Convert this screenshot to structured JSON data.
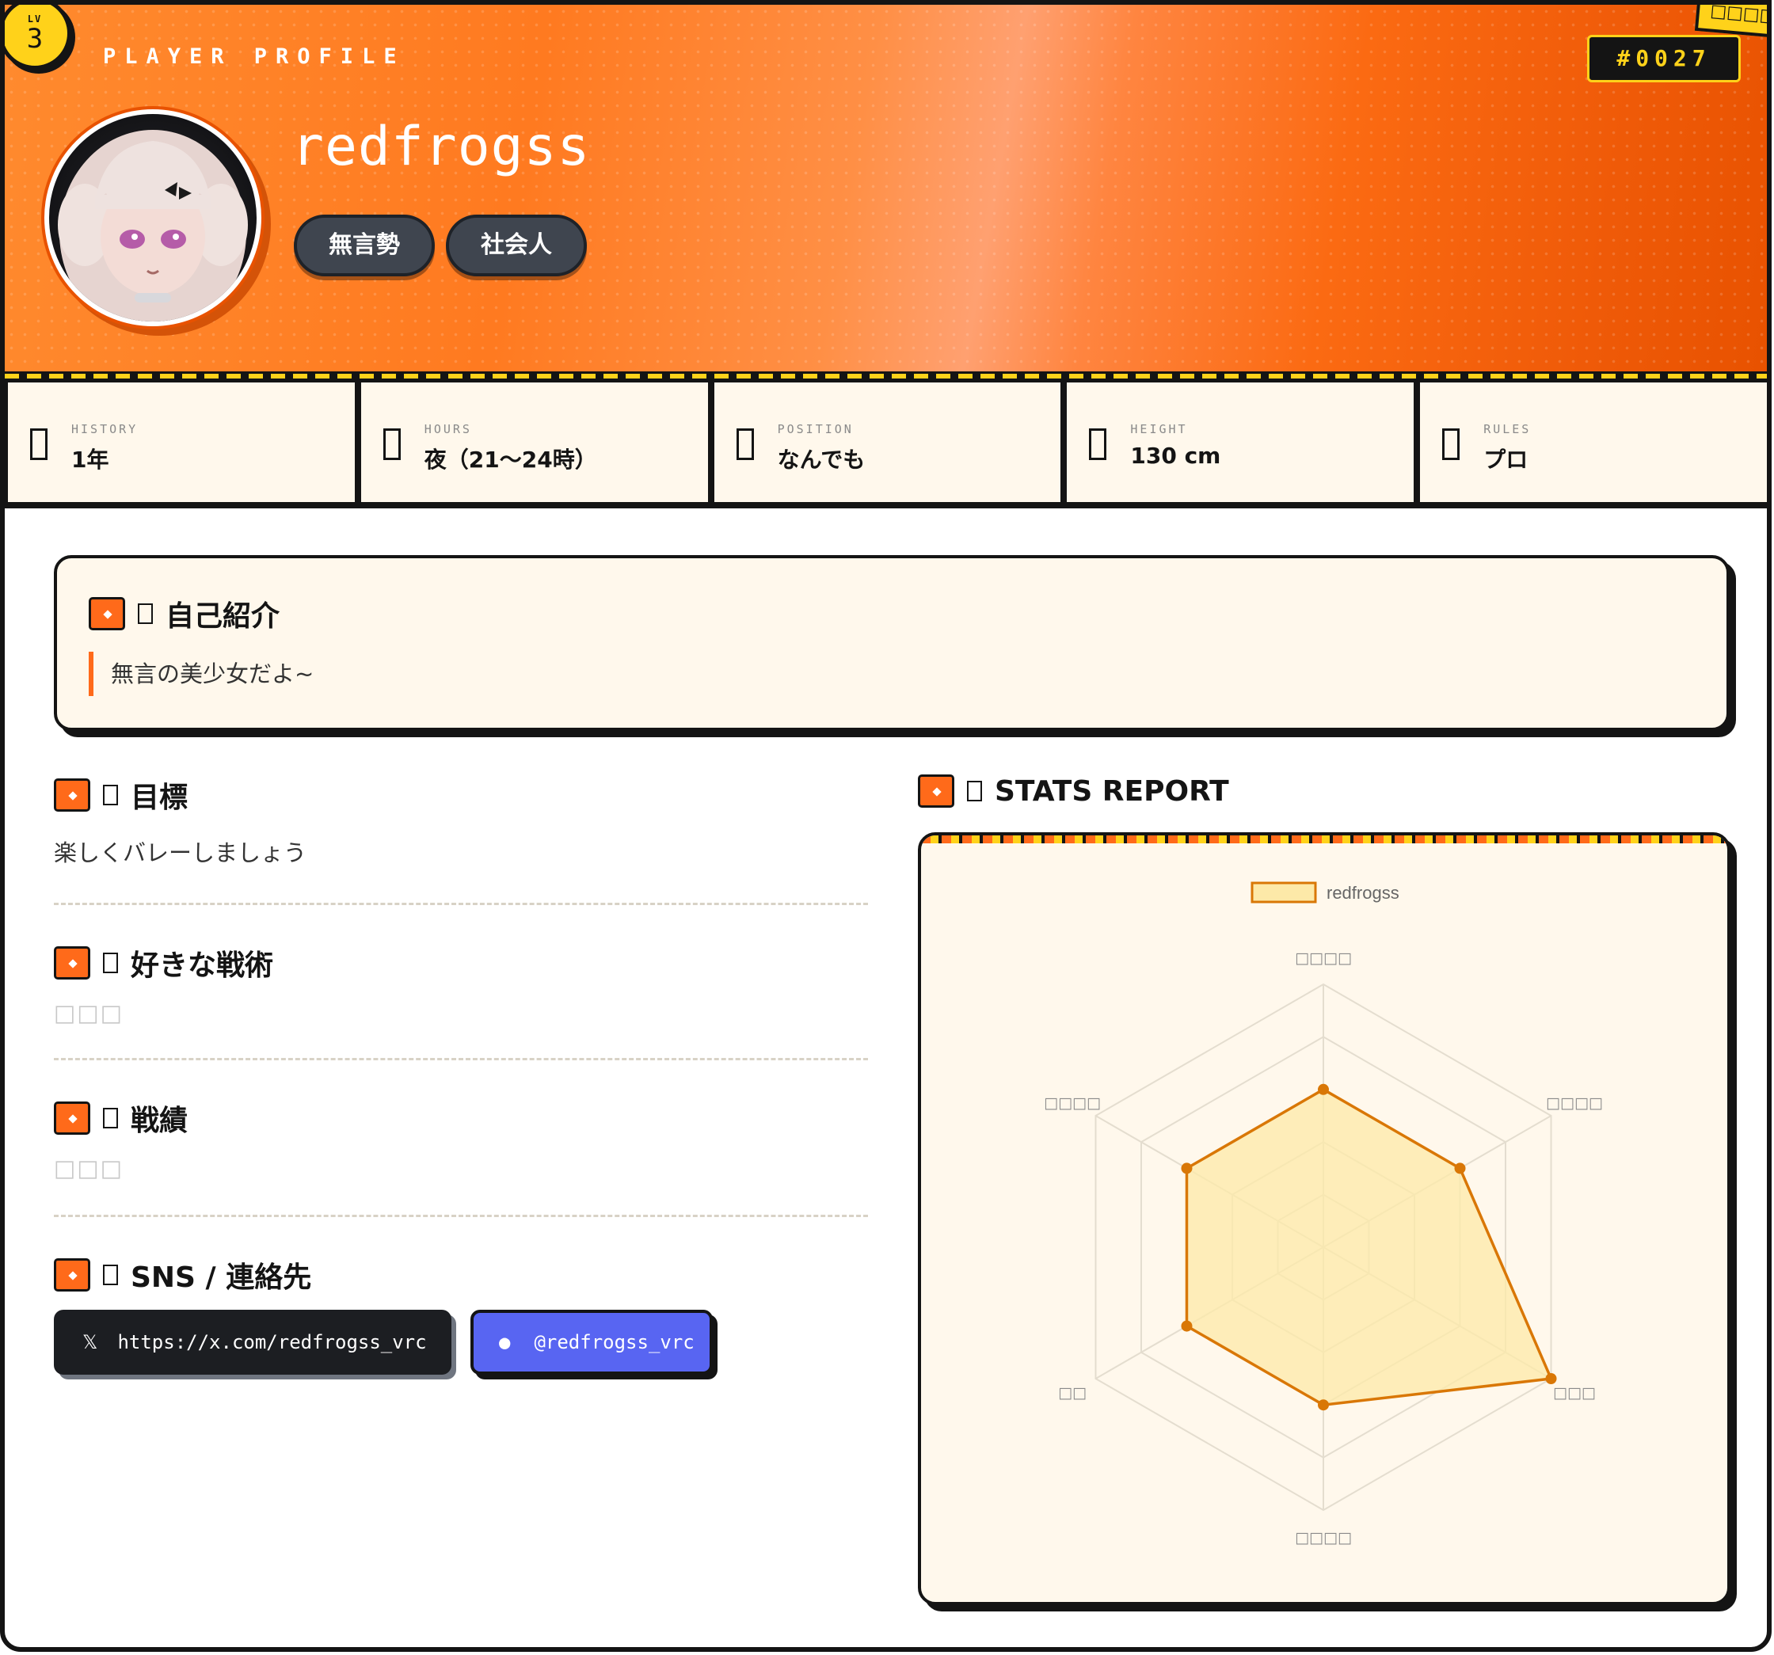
{
  "header": {
    "level_label": "LV",
    "level": "3",
    "section_label": "PLAYER PROFILE",
    "player_id": "#0027",
    "corner_tag": "□□□□",
    "username": "redfrogss",
    "tags": [
      "無言勢",
      "社会人"
    ]
  },
  "stats": [
    {
      "label": "HISTORY",
      "value": "1年",
      "icon": "history-icon"
    },
    {
      "label": "HOURS",
      "value": "夜（21〜24時）",
      "icon": "clock-icon"
    },
    {
      "label": "POSITION",
      "value": "なんでも",
      "icon": "position-icon"
    },
    {
      "label": "HEIGHT",
      "value": "130 cm",
      "icon": "ruler-icon"
    },
    {
      "label": "RULES",
      "value": "プロ",
      "icon": "rules-icon"
    }
  ],
  "intro": {
    "title": "自己紹介",
    "text": "無言の美少女だよ~"
  },
  "goal": {
    "title": "目標",
    "text": "楽しくバレーしましょう"
  },
  "tactics": {
    "title": "好きな戦術",
    "text": "□□□"
  },
  "record": {
    "title": "戦績",
    "text": "□□□"
  },
  "sns": {
    "title": "SNS / 連絡先",
    "x_glyph": "𝕏",
    "x_url": "https://x.com/redfrogss_vrc",
    "discord_glyph": "●",
    "discord_handle": "@redfrogss_vrc"
  },
  "stats_report": {
    "title": "STATS REPORT"
  },
  "colors": {
    "accent_orange": "#ff6a1a",
    "accent_yellow": "#ffd21a",
    "dark": "#141414",
    "cream": "#fff8ec",
    "radar_line": "#d97706",
    "radar_fill": "#fde9a8",
    "discord_blue": "#5865f2"
  },
  "chart_data": {
    "type": "radar",
    "legend": [
      "redfrogss"
    ],
    "axes": [
      "□□□□",
      "□□□□",
      "□□□",
      "□□□□",
      "□□",
      "□□□□"
    ],
    "scale_max": 5,
    "rings": 5,
    "series": [
      {
        "name": "redfrogss",
        "values": [
          3,
          3,
          5,
          3,
          3,
          3
        ]
      }
    ]
  }
}
